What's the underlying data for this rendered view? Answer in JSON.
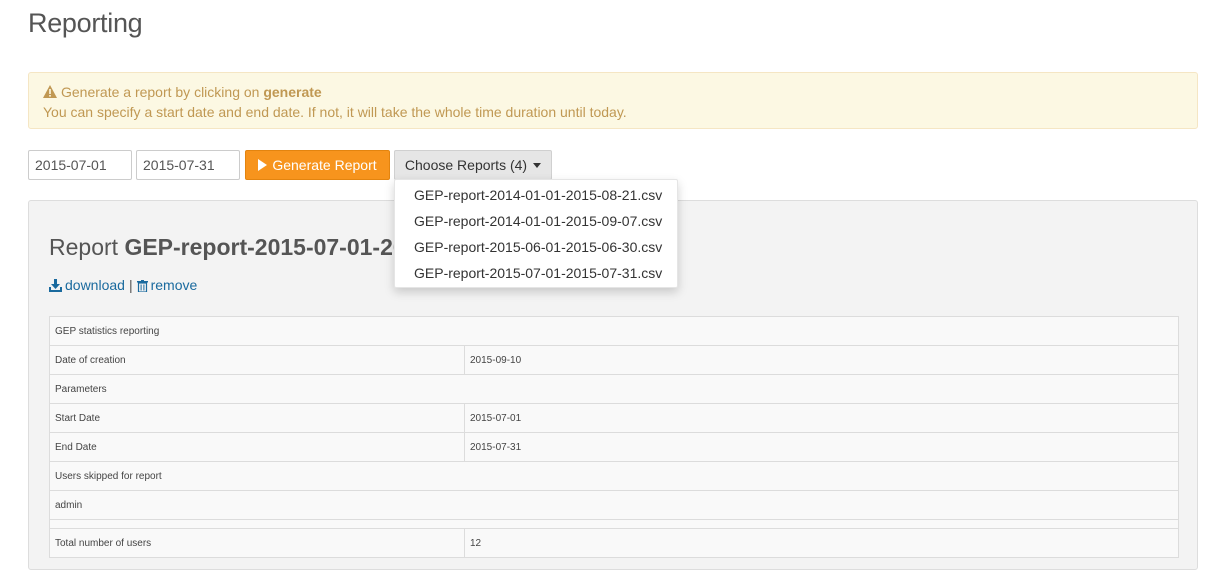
{
  "page": {
    "title": "Reporting"
  },
  "alert": {
    "line1_prefix": "Generate a report by clicking on",
    "line1_bold": "generate",
    "line2": "You can specify a start date and end date. If not, it will take the whole time duration until today.",
    "icon": "warning-icon"
  },
  "controls": {
    "start_date": "2015-07-01",
    "end_date": "2015-07-31",
    "generate_label": "Generate Report",
    "choose_label": "Choose Reports (4)"
  },
  "dropdown": {
    "items": [
      "GEP-report-2014-01-01-2015-08-21.csv",
      "GEP-report-2014-01-01-2015-09-07.csv",
      "GEP-report-2015-06-01-2015-06-30.csv",
      "GEP-report-2015-07-01-2015-07-31.csv"
    ]
  },
  "report": {
    "title_prefix": "Report",
    "title_name": "GEP-report-2015-07-01-2015-07-31.csv",
    "download_label": "download",
    "remove_label": "remove",
    "separator": "|"
  },
  "table": {
    "rows": [
      {
        "label": "GEP statistics reporting"
      },
      {
        "label": "Date of creation",
        "value": "2015-09-10"
      },
      {
        "label": "Parameters"
      },
      {
        "label": "Start Date",
        "value": "2015-07-01"
      },
      {
        "label": "End Date",
        "value": "2015-07-31"
      },
      {
        "label": "Users skipped for report"
      },
      {
        "label": "admin"
      },
      {
        "label": "Total number of users",
        "value": "12"
      }
    ]
  },
  "colors": {
    "accent": "#f7941d",
    "alert_bg": "#fcf8e3",
    "alert_text": "#c09853",
    "link": "#1a6a9e"
  }
}
